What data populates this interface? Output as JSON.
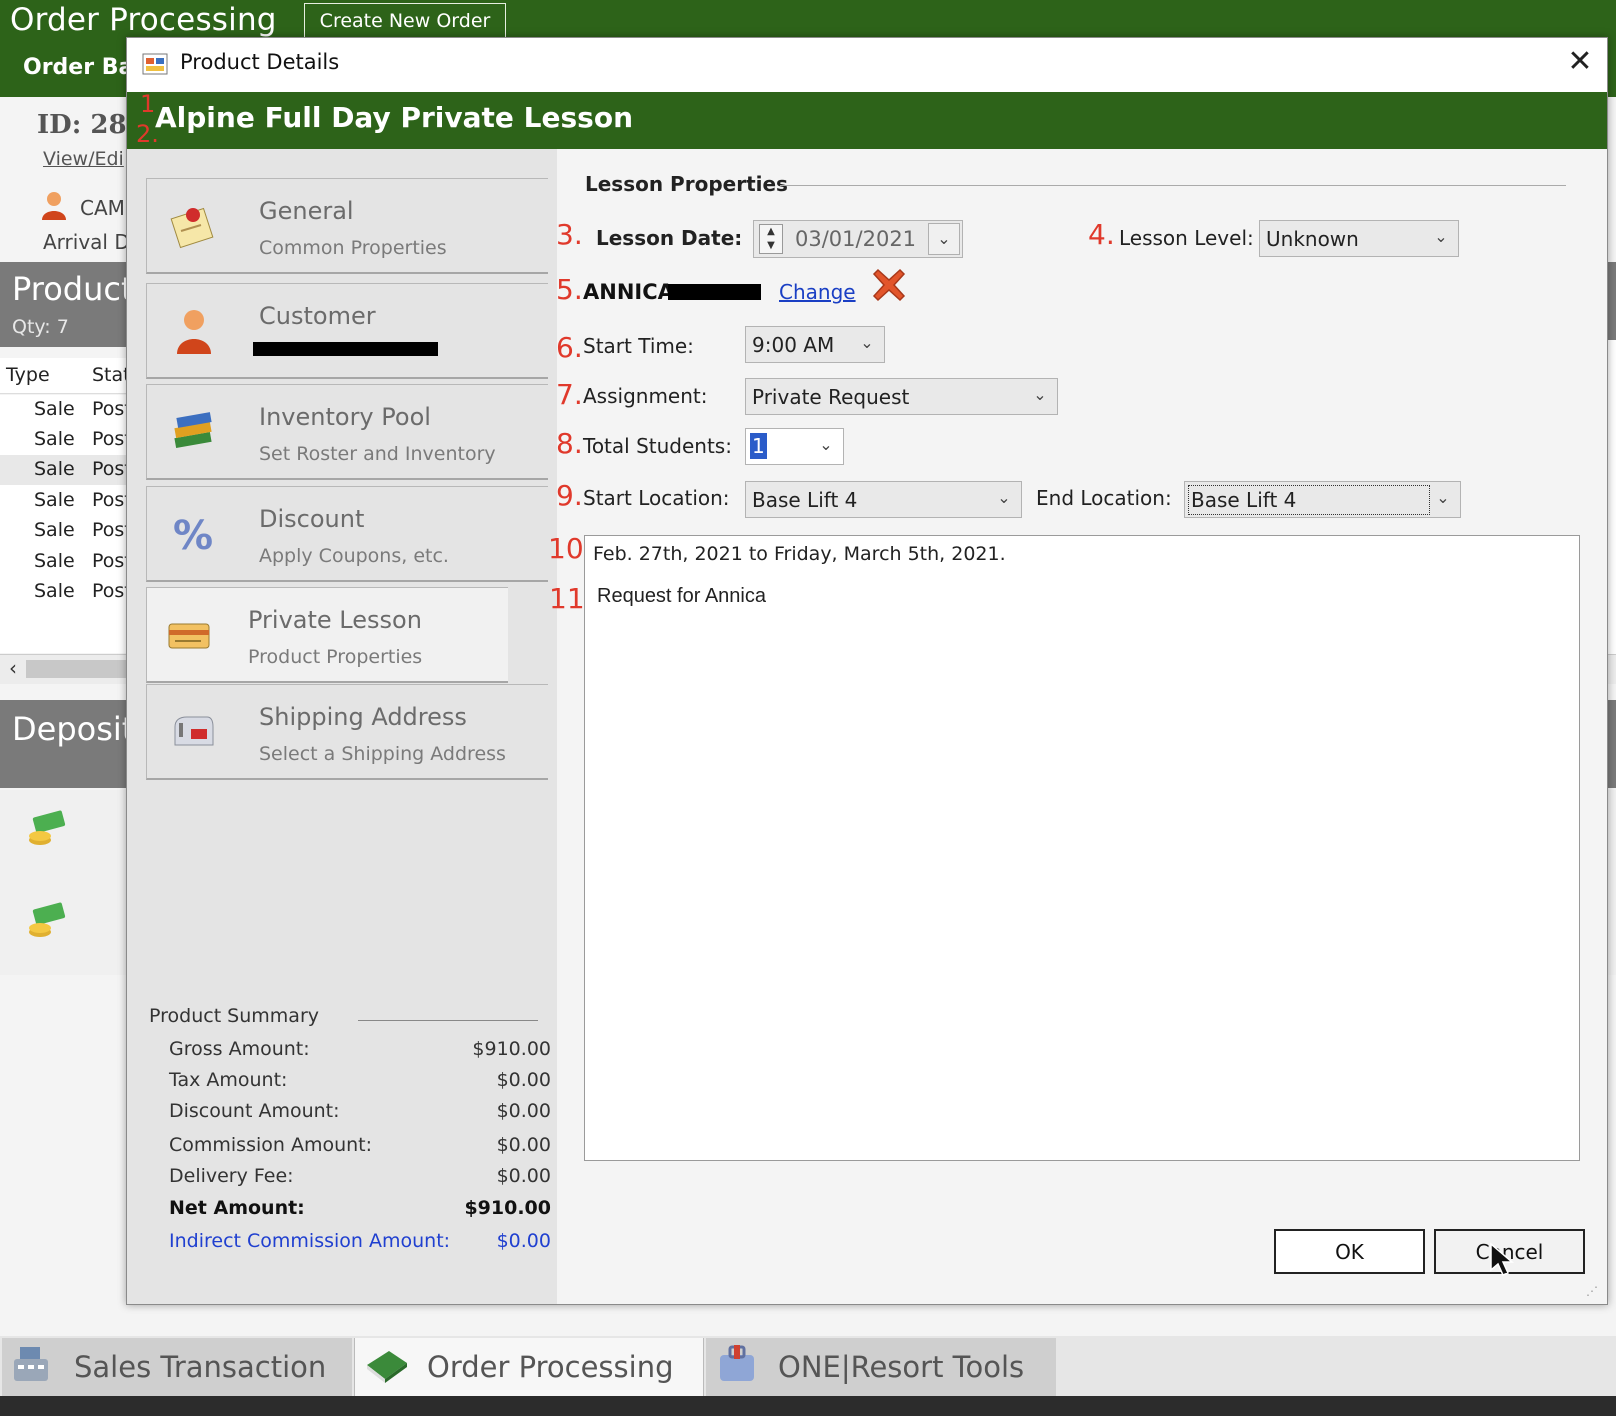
{
  "app": {
    "title": "Order Processing",
    "create_order_label": "Create New Order",
    "order_batch_label": "Order Ba",
    "order_id": "ID: 28",
    "view_edit_link": "View/Edi",
    "customer_short": "CAM",
    "arrival_label": "Arrival D"
  },
  "products": {
    "title": "Product",
    "qty": "Qty: 7",
    "columns": [
      "Type",
      "Stat"
    ],
    "rows": [
      {
        "type": "Sale",
        "status": "Post"
      },
      {
        "type": "Sale",
        "status": "Post"
      },
      {
        "type": "Sale",
        "status": "Post"
      },
      {
        "type": "Sale",
        "status": "Post"
      },
      {
        "type": "Sale",
        "status": "Post"
      },
      {
        "type": "Sale",
        "status": "Post"
      },
      {
        "type": "Sale",
        "status": "Post"
      }
    ]
  },
  "deposits": {
    "title": "Deposit"
  },
  "bottom_tabs": {
    "sales": "Sales Transaction",
    "order": "Order Processing",
    "resort": "ONE|Resort Tools"
  },
  "dialog": {
    "title": "Product Details",
    "close_glyph": "✕",
    "product_name": "Alpine Full Day Private Lesson",
    "nav": {
      "general": {
        "title": "General",
        "sub": "Common Properties"
      },
      "customer": {
        "title": "Customer"
      },
      "inventory": {
        "title": "Inventory Pool",
        "sub": "Set Roster and Inventory"
      },
      "discount": {
        "title": "Discount",
        "sub": "Apply Coupons, etc."
      },
      "lesson": {
        "title": "Private Lesson",
        "sub": "Product Properties"
      },
      "shipping": {
        "title": "Shipping Address",
        "sub": "Select a Shipping Address"
      }
    },
    "summary": {
      "title": "Product Summary",
      "gross_label": "Gross Amount:",
      "gross_value": "$910.00",
      "tax_label": "Tax Amount:",
      "tax_value": "$0.00",
      "discount_label": "Discount Amount:",
      "discount_value": "$0.00",
      "commission_label": "Commission Amount:",
      "commission_value": "$0.00",
      "delivery_label": "Delivery Fee:",
      "delivery_value": "$0.00",
      "net_label": "Net Amount:",
      "net_value": "$910.00",
      "indirect_label": "Indirect Commission Amount:",
      "indirect_value": "$0.00"
    },
    "lesson": {
      "section_title": "Lesson Properties",
      "date_label": "Lesson Date:",
      "date_value": "03/01/2021",
      "level_label": "Lesson Level:",
      "level_value": "Unknown",
      "customer_name": "ANNICA",
      "change_link": "Change",
      "start_time_label": "Start Time:",
      "start_time_value": "9:00 AM",
      "assignment_label": "Assignment:",
      "assignment_value": "Private Request",
      "students_label": "Total Students:",
      "students_value": "1",
      "start_location_label": "Start Location:",
      "start_location_value": "Base Lift 4",
      "end_location_label": "End Location:",
      "end_location_value": "Base Lift 4",
      "notes_line1": "Feb. 27th, 2021 to Friday, March 5th, 2021.",
      "notes_line2": "Request for Annica"
    },
    "annotations": {
      "n1": "1",
      "n2": "2.",
      "n3": "3.",
      "n4": "4.",
      "n5": "5.",
      "n6": "6.",
      "n7": "7.",
      "n8": "8.",
      "n9": "9.",
      "n10": "10.",
      "n11": "11."
    },
    "ok_label": "OK",
    "cancel_label": "Cancel"
  },
  "colors": {
    "header_green": "#2d6319",
    "panel_gray": "#7a7a7a",
    "annotation_red": "#e0392b",
    "link_blue": "#1a3fc4"
  }
}
